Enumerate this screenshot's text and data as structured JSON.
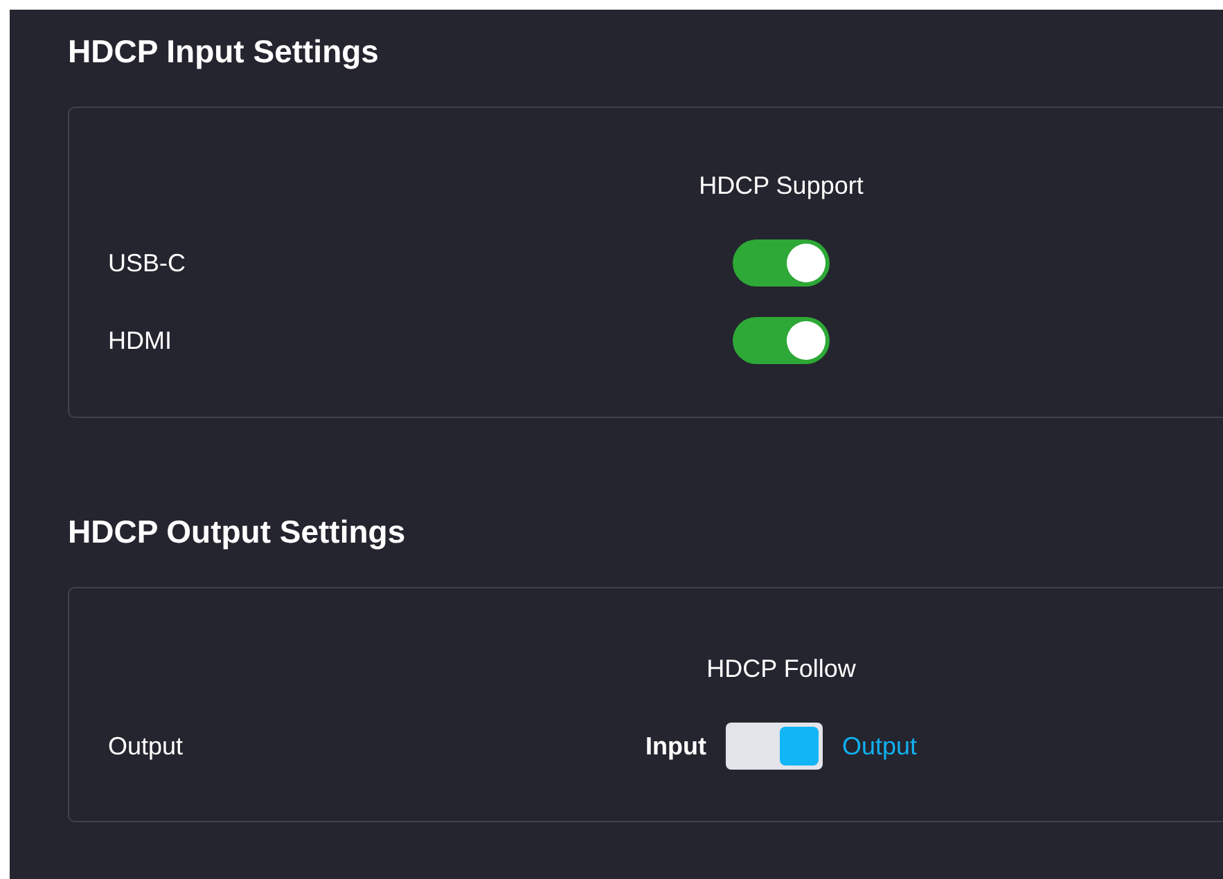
{
  "sections": [
    {
      "title": "HDCP Input Settings",
      "column_header": "HDCP Support",
      "rows": [
        {
          "label": "USB-C",
          "kind": "toggle",
          "on": true
        },
        {
          "label": "HDMI",
          "kind": "toggle",
          "on": true
        }
      ]
    },
    {
      "title": "HDCP Output Settings",
      "column_header": "HDCP Follow",
      "rows": [
        {
          "label": "Output",
          "kind": "switch",
          "options": [
            {
              "label": "Input",
              "selected": false
            },
            {
              "label": "Output",
              "selected": true
            }
          ]
        }
      ]
    }
  ]
}
